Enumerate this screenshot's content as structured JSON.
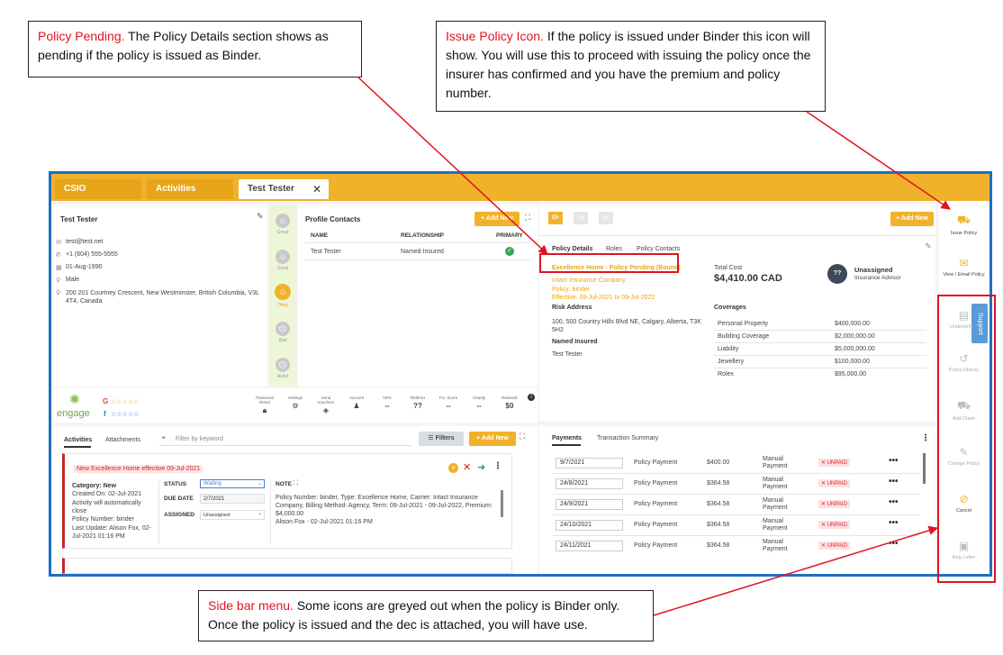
{
  "annotations": {
    "pending_title": "Policy Pending.",
    "pending_body": " The Policy Details section shows as pending if the policy is issued as Binder.",
    "issue_title": "Issue Policy Icon.",
    "issue_body": "  If the policy is issued under Binder this icon will show.  You will use this to proceed with issuing the policy once the insurer has confirmed and you have the premium and policy number.",
    "sidebar_title": "Side bar menu.",
    "sidebar_body": "  Some icons are greyed out when the policy is Binder only.  Once the policy is issued and the dec is attached, you will have use."
  },
  "tabs": [
    {
      "label": "CSIO"
    },
    {
      "label": "Activities"
    },
    {
      "label": "Test Tester",
      "close": "✕"
    }
  ],
  "contact": {
    "name": "Test Tester",
    "email": "test@test.net",
    "phone": "+1 (604) 555-5555",
    "dob": "01-Aug-1990",
    "gender": "Male",
    "address": "200 201 Courtney Crescent, New Westminster, British Columbia, V3L 4T4, Canada"
  },
  "moods": [
    "Great",
    "Good",
    "Okay",
    "Bad",
    "Awful"
  ],
  "profile_contacts": {
    "title": "Profile Contacts",
    "add_label": "+ Add New",
    "headers": [
      "NAME",
      "RELATIONSHIP",
      "PRIMARY"
    ],
    "rows": [
      {
        "name": "Test Tester",
        "relationship": "Named Insured"
      }
    ]
  },
  "engage": {
    "logo": "engage",
    "google": "G",
    "facebook": "f",
    "stars": "☆☆☆☆☆",
    "stats": [
      {
        "label": "Password Reset",
        "value": ""
      },
      {
        "label": "Settings",
        "value": ""
      },
      {
        "label": "Send Vouchers",
        "value": ""
      },
      {
        "label": "Account",
        "value": ""
      },
      {
        "label": "NPS",
        "value": "--"
      },
      {
        "label": "Referrer",
        "value": "??"
      },
      {
        "label": "Fin. Score",
        "value": "--"
      },
      {
        "label": "Charity",
        "value": "--"
      },
      {
        "label": "Rewards",
        "value": "$0"
      }
    ]
  },
  "activities": {
    "tab_activities": "Activities",
    "tab_attachments": "Attachments",
    "filter_placeholder": "Filter by keyword",
    "filters_label": "Filters",
    "add_label": "+ Add New",
    "card": {
      "title": "New Excellence Home effective 09-Jul-2021",
      "category": "Category: New",
      "created": "Created On: 02-Jul-2021",
      "auto_close": "Activity will automatically close",
      "policy_number": "Policy Number: binder",
      "last_update": "Last Update: Alison Fox, 02-Jul-2021 01:16 PM",
      "status_label": "STATUS",
      "status_value": "Waiting",
      "due_label": "DUE DATE",
      "due_value": "2/7/2021",
      "assigned_label": "ASSIGNED",
      "assigned_value": "Unassigned",
      "note_label": "NOTE",
      "note_text": "Policy Number: binder, Type: Excellence Home, Carrier: Intact Insurance Company, Billing Method: Agency, Term: 09-Jul-2021 - 09-Jul-2022, Premium: $4,000.00",
      "note_author": "Alison Fox - 02-Jul-2021 01:16 PM"
    }
  },
  "policy": {
    "chips": [
      "Eh",
      "Fp",
      "Bk"
    ],
    "add_label": "+ Add New",
    "tabs": [
      "Policy Details",
      "Roles",
      "Policy Contacts"
    ],
    "status_line": "Excellence Home - Policy Pending (Bound)",
    "carrier": "Intact Insurance Company",
    "policy_no": "Policy: binder",
    "effective": "Effective: 09-Jul-2021 to 09-Jul-2022",
    "risk_label": "Risk Address",
    "risk_address": "100, 500 Country Hills Blvd NE, Calgary, Alberta, T3K 5H2",
    "named_label": "Named Insured",
    "named_value": "Test Tester",
    "total_label": "Total Cost",
    "total_value": "$4,410.00 CAD",
    "advisor_initials": "??",
    "advisor_name": "Unassigned",
    "advisor_role": "Insurance Advisor",
    "coverages_label": "Coverages",
    "coverages": [
      {
        "name": "Personal Property",
        "amount": "$400,000.00"
      },
      {
        "name": "Building Coverage",
        "amount": "$2,000,000.00"
      },
      {
        "name": "Liability",
        "amount": "$5,000,000.00"
      },
      {
        "name": "Jewellery",
        "amount": "$100,000.00"
      },
      {
        "name": "Rolex",
        "amount": "$95,000.00"
      }
    ]
  },
  "payments": {
    "tab_payments": "Payments",
    "tab_transactions": "Transaction Summary",
    "rows": [
      {
        "date": "9/7/2021",
        "type": "Policy Payment",
        "amount": "$400.00",
        "method": "Manual Payment",
        "status": "✕ UNPAID"
      },
      {
        "date": "24/8/2021",
        "type": "Policy Payment",
        "amount": "$364.58",
        "method": "Manual Payment",
        "status": "✕ UNPAID"
      },
      {
        "date": "24/9/2021",
        "type": "Policy Payment",
        "amount": "$364.58",
        "method": "Manual Payment",
        "status": "✕ UNPAID"
      },
      {
        "date": "24/10/2021",
        "type": "Policy Payment",
        "amount": "$364.58",
        "method": "Manual Payment",
        "status": "✕ UNPAID"
      },
      {
        "date": "24/11/2021",
        "type": "Policy Payment",
        "amount": "$364.58",
        "method": "Manual Payment",
        "status": "✕ UNPAID"
      }
    ]
  },
  "sidebar": {
    "items": [
      {
        "label": "Issue Policy",
        "icon": "issue-policy-icon"
      },
      {
        "label": "View / Email Policy",
        "icon": "email-icon"
      },
      {
        "label": "Underwriting",
        "icon": "underwriting-icon"
      },
      {
        "label": "Policy History",
        "icon": "history-icon"
      },
      {
        "label": "Add Claim",
        "icon": "truck-icon"
      },
      {
        "label": "Change Policy",
        "icon": "edit-doc-icon"
      },
      {
        "label": "Cancel",
        "icon": "cancel-icon"
      },
      {
        "label": "Reg Letter",
        "icon": "letter-icon"
      }
    ],
    "support_label": "Support"
  }
}
